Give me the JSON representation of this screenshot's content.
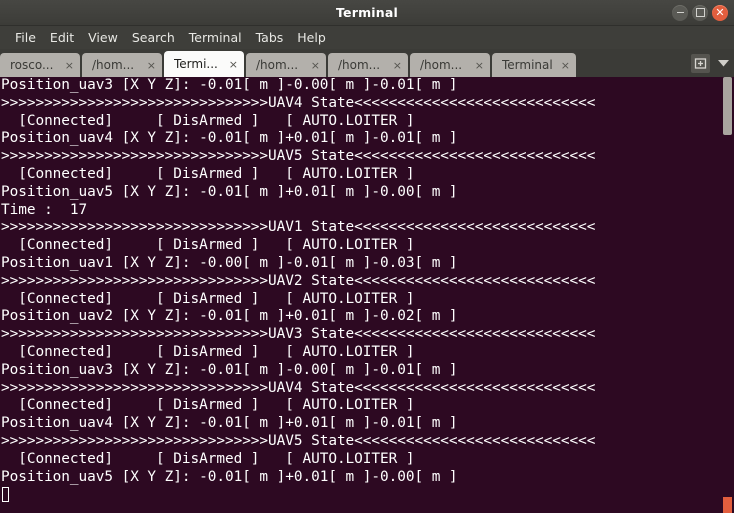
{
  "window": {
    "title": "Terminal",
    "controls": [
      {
        "name": "minimize",
        "glyph": "–"
      },
      {
        "name": "maximize",
        "glyph": "□"
      },
      {
        "name": "close",
        "glyph": "×"
      }
    ]
  },
  "menubar": {
    "items": [
      "File",
      "Edit",
      "View",
      "Search",
      "Terminal",
      "Tabs",
      "Help"
    ]
  },
  "tabbar": {
    "close_glyph": "×",
    "tabs": [
      {
        "label": "rosco...",
        "active": false
      },
      {
        "label": "/hom...",
        "active": false
      },
      {
        "label": "Termi...",
        "active": true
      },
      {
        "label": "/hom...",
        "active": false
      },
      {
        "label": "/hom...",
        "active": false
      },
      {
        "label": "/hom...",
        "active": false
      },
      {
        "label": "Terminal",
        "active": false
      }
    ],
    "new_tab_icon": "new-tab-icon",
    "tab_list_icon": "chevron-down-icon"
  },
  "terminal": {
    "background_color": "#2d0922",
    "foreground_color": "#ffffff",
    "cursor": "block-outline",
    "lines": [
      "Position_uav3 [X Y Z]: -0.01[ m ]-0.00[ m ]-0.01[ m ]",
      ">>>>>>>>>>>>>>>>>>>>>>>>>>>>>>>UAV4 State<<<<<<<<<<<<<<<<<<<<<<<<<<<<",
      "  [Connected]     [ DisArmed ]   [ AUTO.LOITER ]",
      "Position_uav4 [X Y Z]: -0.01[ m ]+0.01[ m ]-0.01[ m ]",
      ">>>>>>>>>>>>>>>>>>>>>>>>>>>>>>>UAV5 State<<<<<<<<<<<<<<<<<<<<<<<<<<<<",
      "  [Connected]     [ DisArmed ]   [ AUTO.LOITER ]",
      "Position_uav5 [X Y Z]: -0.01[ m ]+0.01[ m ]-0.00[ m ]",
      "Time :  17",
      ">>>>>>>>>>>>>>>>>>>>>>>>>>>>>>>UAV1 State<<<<<<<<<<<<<<<<<<<<<<<<<<<<",
      "  [Connected]     [ DisArmed ]   [ AUTO.LOITER ]",
      "Position_uav1 [X Y Z]: -0.00[ m ]-0.01[ m ]-0.03[ m ]",
      ">>>>>>>>>>>>>>>>>>>>>>>>>>>>>>>UAV2 State<<<<<<<<<<<<<<<<<<<<<<<<<<<<",
      "  [Connected]     [ DisArmed ]   [ AUTO.LOITER ]",
      "Position_uav2 [X Y Z]: -0.01[ m ]+0.01[ m ]-0.02[ m ]",
      ">>>>>>>>>>>>>>>>>>>>>>>>>>>>>>>UAV3 State<<<<<<<<<<<<<<<<<<<<<<<<<<<<",
      "  [Connected]     [ DisArmed ]   [ AUTO.LOITER ]",
      "Position_uav3 [X Y Z]: -0.01[ m ]-0.00[ m ]-0.01[ m ]",
      ">>>>>>>>>>>>>>>>>>>>>>>>>>>>>>>UAV4 State<<<<<<<<<<<<<<<<<<<<<<<<<<<<",
      "  [Connected]     [ DisArmed ]   [ AUTO.LOITER ]",
      "Position_uav4 [X Y Z]: -0.01[ m ]+0.01[ m ]-0.01[ m ]",
      ">>>>>>>>>>>>>>>>>>>>>>>>>>>>>>>UAV5 State<<<<<<<<<<<<<<<<<<<<<<<<<<<<",
      "  [Connected]     [ DisArmed ]   [ AUTO.LOITER ]",
      "Position_uav5 [X Y Z]: -0.01[ m ]+0.01[ m ]-0.00[ m ]"
    ]
  },
  "scrollbar": {
    "thumb_color": "#a9a59f",
    "marker_color": "#e25e3e"
  }
}
